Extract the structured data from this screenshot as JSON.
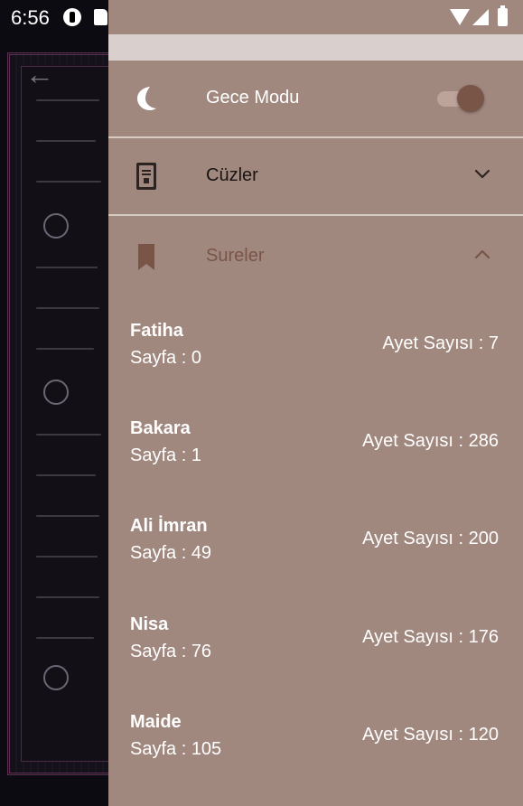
{
  "status_bar": {
    "time": "6:56"
  },
  "drawer": {
    "night_mode": {
      "label": "Gece Modu",
      "enabled": true
    },
    "cuzler": {
      "label": "Cüzler",
      "expanded": false
    },
    "sureler": {
      "label": "Sureler",
      "expanded": true,
      "items": [
        {
          "name": "Fatiha",
          "page": "Sayfa : 0",
          "ayet": "Ayet Sayısı : 7"
        },
        {
          "name": "Bakara",
          "page": "Sayfa : 1",
          "ayet": "Ayet Sayısı : 286"
        },
        {
          "name": "Ali İmran",
          "page": "Sayfa : 49",
          "ayet": "Ayet Sayısı : 200"
        },
        {
          "name": "Nisa",
          "page": "Sayfa : 76",
          "ayet": "Ayet Sayısı : 176"
        },
        {
          "name": "Maide",
          "page": "Sayfa : 105",
          "ayet": "Ayet Sayısı : 120"
        }
      ]
    }
  },
  "colors": {
    "drawer_bg": "#a1887f",
    "accent": "#795548",
    "header_bg": "#d9cfcc"
  }
}
